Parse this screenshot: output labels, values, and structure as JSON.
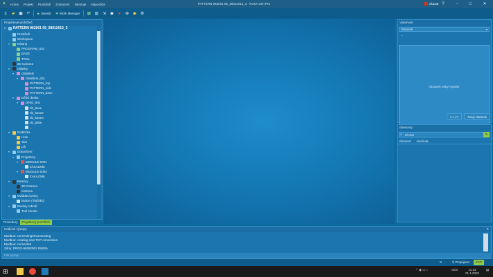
{
  "window": {
    "title": "PATTERN 962001 05_28012013_3 - KUKA.Sim Pro",
    "menu": [
      "Home",
      "Projekt",
      "Prostředí",
      "Zobrazení",
      "Nástroje",
      "Nápověda"
    ],
    "user": "ukazat"
  },
  "toolbar": {
    "connect_label": "Spustit",
    "work_manager_label": "Work Manager"
  },
  "project_panel": {
    "title": "Projektové prohlížeč",
    "root": "PATTERN 962001 05_28012013_3",
    "items": [
      {
        "label": "Prostředí",
        "depth": 1,
        "color": "#8ecff0"
      },
      {
        "label": "Workspace",
        "depth": 1,
        "color": "#8ecff0"
      },
      {
        "label": "Nástroj",
        "depth": 1,
        "color": "#8fd08f"
      },
      {
        "label": "PROGRAM_001",
        "depth": 2,
        "color": "#8fd08f"
      },
      {
        "label": "BASE",
        "depth": 2,
        "color": "#8fd08f"
      },
      {
        "label": "TOOL",
        "depth": 2,
        "color": "#8fd08f"
      },
      {
        "label": "3D Camera",
        "depth": 1,
        "color": "#333333"
      },
      {
        "label": "Objekty",
        "depth": 1,
        "color": "#333333"
      },
      {
        "label": "Obdélník",
        "depth": 2,
        "color": "#d78fd6"
      },
      {
        "label": "Obdélník_001",
        "depth": 3,
        "color": "#d78fd6"
      },
      {
        "label": "PATTERN_top",
        "depth": 4,
        "color": "#d78fd6"
      },
      {
        "label": "PATTERN_side",
        "depth": 4,
        "color": "#d78fd6"
      },
      {
        "label": "PATTERN_base",
        "depth": 4,
        "color": "#d78fd6"
      },
      {
        "label": "Dělicí deska",
        "depth": 2,
        "color": "#d78fd6"
      },
      {
        "label": "Dělicí_001",
        "depth": 3,
        "color": "#d78fd6"
      },
      {
        "label": "rib_base",
        "depth": 4,
        "color": "#cfe6f5"
      },
      {
        "label": "rib_base2",
        "depth": 4,
        "color": "#cfe6f5"
      },
      {
        "label": "rib_base3",
        "depth": 4,
        "color": "#cfe6f5"
      },
      {
        "label": "rib_plate",
        "depth": 4,
        "color": "#cfe6f5"
      },
      {
        "label": "...",
        "depth": 4,
        "color": "#cfe6f5"
      },
      {
        "label": "Podložka",
        "depth": 1,
        "color": "#f2c94c"
      },
      {
        "label": "Hole",
        "depth": 2,
        "color": "#f2c94c"
      },
      {
        "label": "Slot",
        "depth": 2,
        "color": "#f2c94c"
      },
      {
        "label": "Lift",
        "depth": 2,
        "color": "#f2c94c"
      },
      {
        "label": "Dokončení",
        "depth": 1,
        "color": "#8ecff0"
      },
      {
        "label": "Projektory",
        "depth": 2,
        "color": "#8ecff0"
      },
      {
        "label": "MODULE-0001",
        "depth": 3,
        "color": "#e05555"
      },
      {
        "label": "ZÁKAZNÍK",
        "depth": 4,
        "color": "#cfe6f5"
      },
      {
        "label": "MODULE-0002",
        "depth": 3,
        "color": "#e05555"
      },
      {
        "label": "ZÁKAZNÍK",
        "depth": 4,
        "color": "#cfe6f5"
      },
      {
        "label": "Kamery",
        "depth": 1,
        "color": "#333333"
      },
      {
        "label": "3D Camera",
        "depth": 2,
        "color": "#333333"
      },
      {
        "label": "Camera",
        "depth": 2,
        "color": "#333333"
      },
      {
        "label": "Ovládací prvky",
        "depth": 1,
        "color": "#8ecff0"
      },
      {
        "label": "Button (Tlačítko)",
        "depth": 2,
        "color": "#cfe6f5"
      },
      {
        "label": "Moduly robotů",
        "depth": 1,
        "color": "#8ecff0"
      },
      {
        "label": "Tool Center",
        "depth": 2,
        "color": "#8ecff0"
      }
    ]
  },
  "left_tabs": [
    "Procedury",
    "Projektový prohlížeč"
  ],
  "properties_panel": {
    "title": "Vlastnosti",
    "selector": "Obrázek",
    "subfield": "--",
    "preview_text": "Obrázek nebyl vybrán",
    "btn_apply": "Použít",
    "btn_new": "Nový obrázek"
  },
  "elements_panel": {
    "title": "Elementy",
    "search_placeholder": "Hledat",
    "go_icon": "pencil-icon",
    "columns": [
      "Element",
      "Hodnota"
    ]
  },
  "log_panel": {
    "title": "Události výstupy",
    "lines": [
      "Modbus: connecting/reconnecting",
      "Modbus: creating new TCP connection",
      "Modbus: connected",
      "Zdroj: PROG-96262001 05/03A"
    ],
    "filter_placeholder": "Filtr výstup"
  },
  "status": {
    "label": "Propojeno",
    "mode": "TCP"
  },
  "taskbar": {
    "time": "11:23",
    "date": "21.1.2020",
    "lang": "CES"
  }
}
